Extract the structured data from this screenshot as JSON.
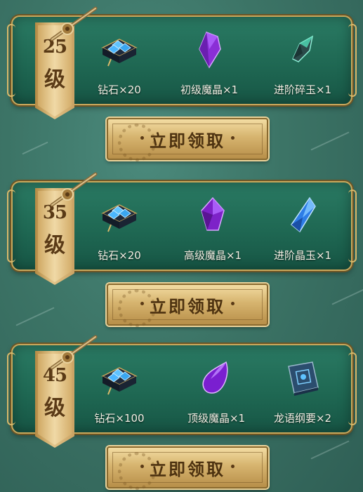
{
  "tiers": [
    {
      "level": "25",
      "level_char": "级",
      "claim_label": "立即领取",
      "rewards": [
        {
          "label": "钻石×20",
          "icon": "diamond-chest-icon"
        },
        {
          "label": "初级魔晶×1",
          "icon": "purple-crystal-icon"
        },
        {
          "label": "进阶碎玉×1",
          "icon": "jade-shard-icon"
        }
      ]
    },
    {
      "level": "35",
      "level_char": "级",
      "claim_label": "立即领取",
      "rewards": [
        {
          "label": "钻石×20",
          "icon": "diamond-chest-icon"
        },
        {
          "label": "高级魔晶×1",
          "icon": "purple-gem-icon"
        },
        {
          "label": "进阶晶玉×1",
          "icon": "blue-crystal-icon"
        }
      ]
    },
    {
      "level": "45",
      "level_char": "级",
      "claim_label": "立即领取",
      "rewards": [
        {
          "label": "钻石×100",
          "icon": "diamond-chest-icon"
        },
        {
          "label": "顶级魔晶×1",
          "icon": "purple-teardrop-gem-icon"
        },
        {
          "label": "龙语纲要×2",
          "icon": "dragon-tome-icon"
        }
      ]
    }
  ],
  "colors": {
    "panel": "#1f6853",
    "gold": "#c9a85c",
    "text_dark": "#5a3a16"
  }
}
